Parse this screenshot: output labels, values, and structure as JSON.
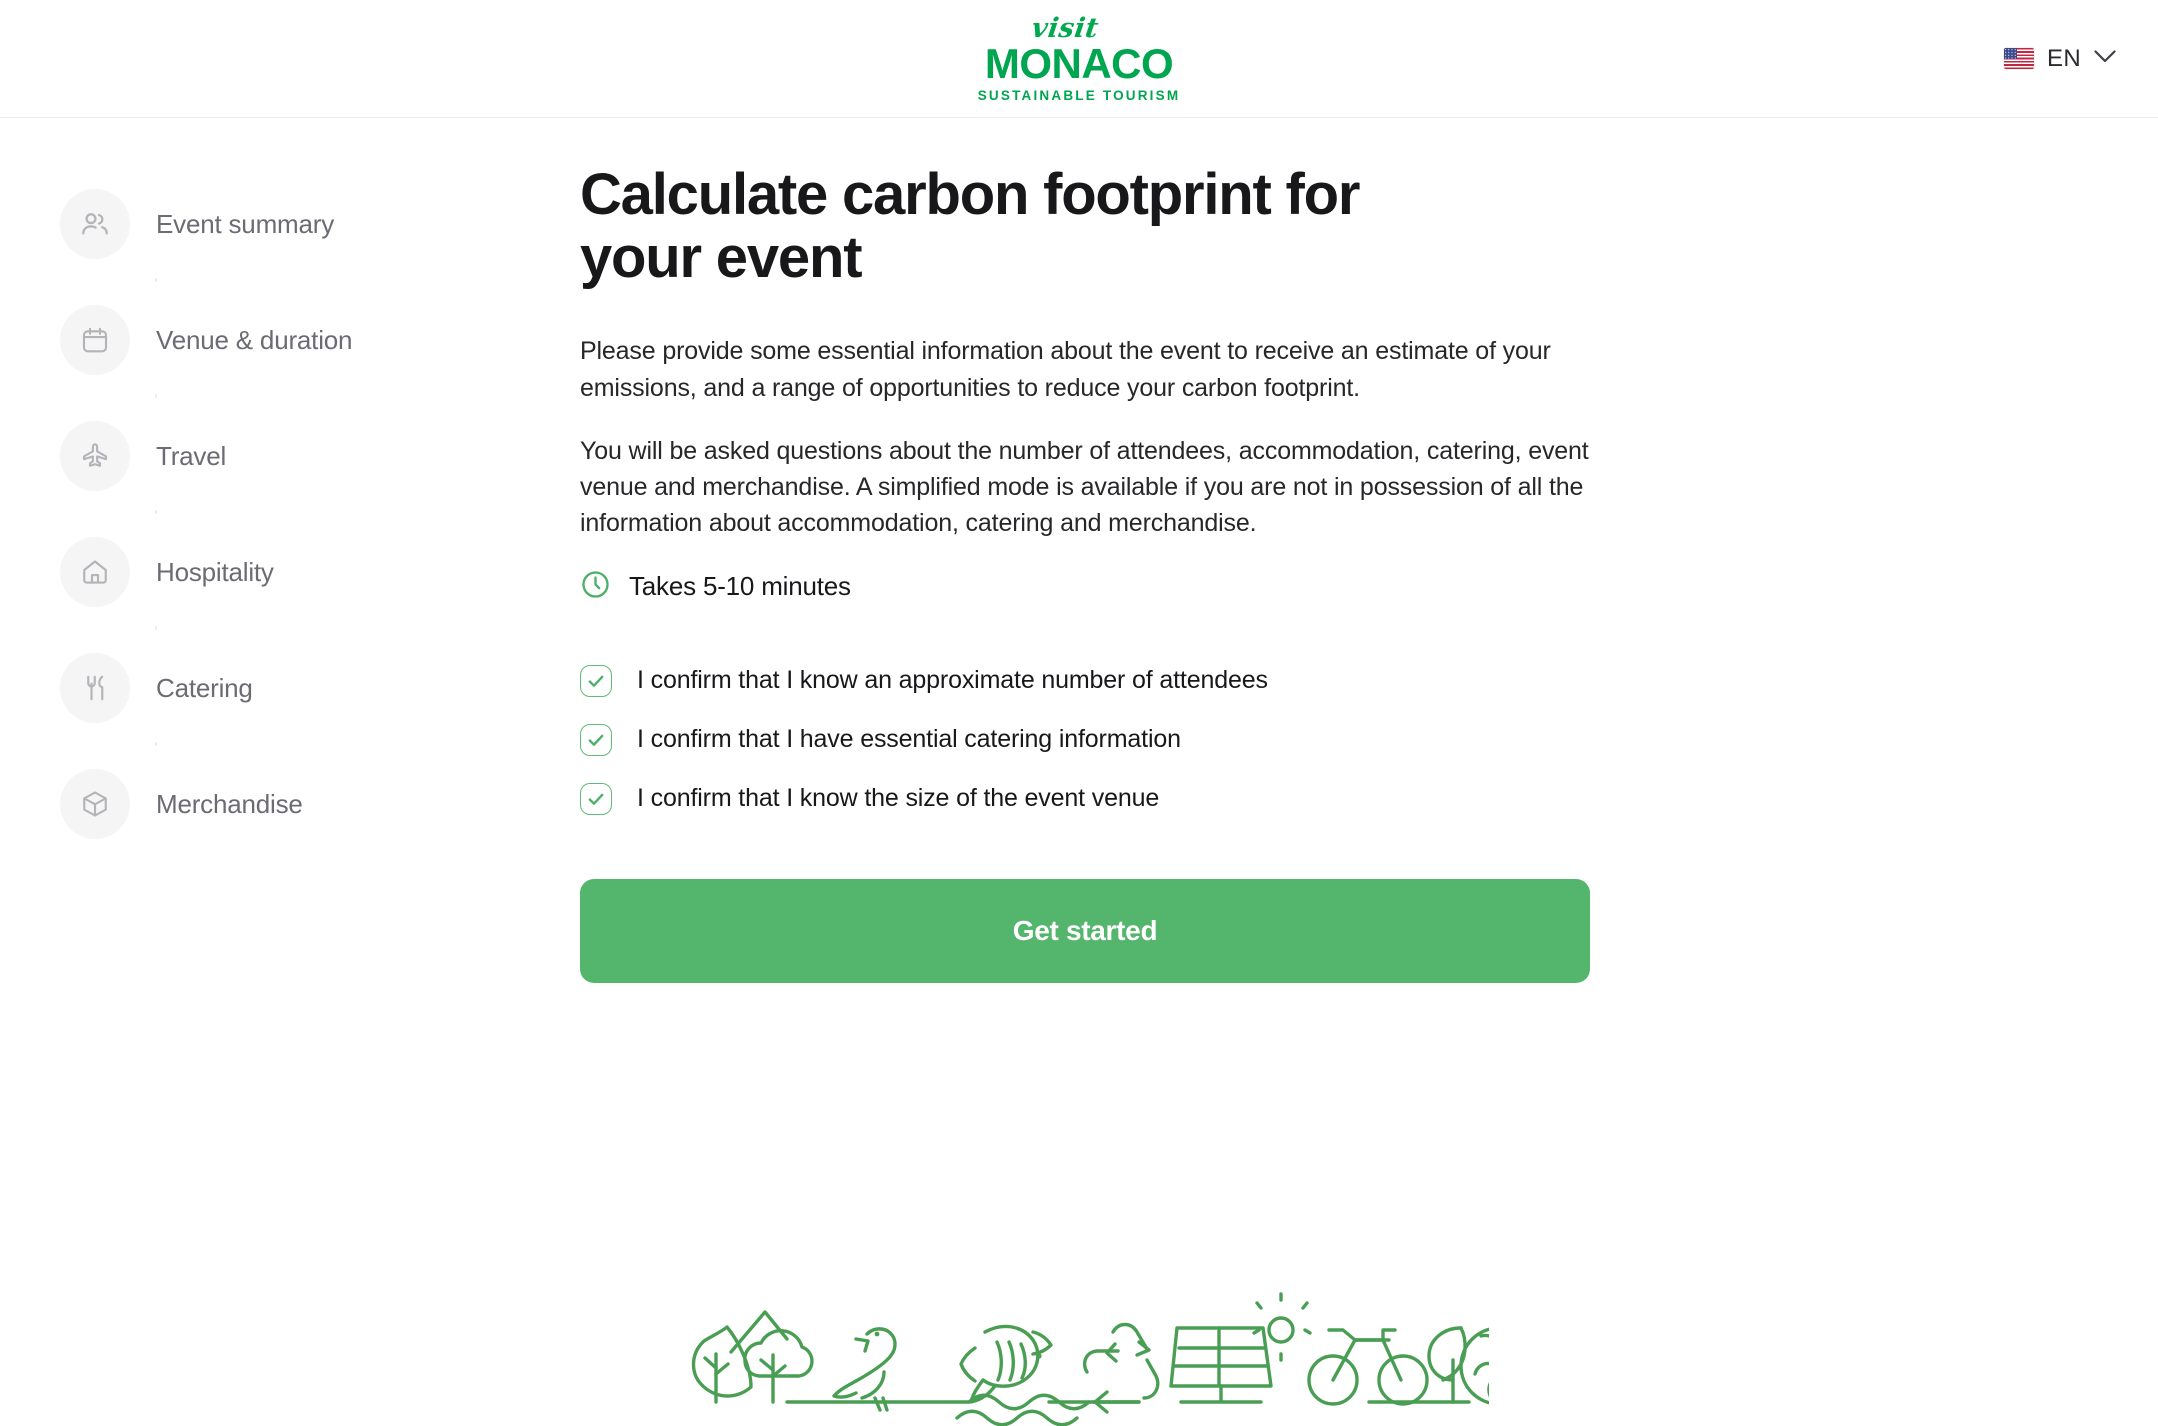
{
  "header": {
    "logo": {
      "script_word": "visit",
      "brand": "MONACO",
      "tagline": "SUSTAINABLE TOURISM"
    },
    "language": {
      "flag_icon": "us-flag-icon",
      "code": "EN",
      "chevron_icon": "chevron-down-icon"
    }
  },
  "sidebar": {
    "items": [
      {
        "label": "Event summary",
        "icon": "users-icon"
      },
      {
        "label": "Venue & duration",
        "icon": "calendar-icon"
      },
      {
        "label": "Travel",
        "icon": "airplane-icon"
      },
      {
        "label": "Hospitality",
        "icon": "house-icon"
      },
      {
        "label": "Catering",
        "icon": "fork-knife-icon"
      },
      {
        "label": "Merchandise",
        "icon": "box-icon"
      }
    ]
  },
  "main": {
    "title": "Calculate carbon footprint for your event",
    "paragraph_1": "Please provide some essential information about the event to receive an estimate of your emissions, and a range of opportunities to reduce your carbon footprint.",
    "paragraph_2": "You will be asked questions about the number of attendees, accommodation, catering, event venue and merchandise. A simplified mode is available if you are not in possession of all the information about accommodation, catering and merchandise.",
    "duration": {
      "icon": "clock-icon",
      "text": "Takes 5-10 minutes"
    },
    "checklist": [
      {
        "label": "I confirm that I know an approximate number of attendees",
        "checked": true
      },
      {
        "label": "I confirm that I have essential catering information",
        "checked": true
      },
      {
        "label": "I confirm that I know the size of the event venue",
        "checked": true
      }
    ],
    "cta_label": "Get started"
  },
  "footer": {
    "illustration_icons": [
      "leaf-icon",
      "tree-icon",
      "bird-icon",
      "fish-icon",
      "waves-icon",
      "recycle-icon",
      "solar-panel-icon",
      "sun-icon",
      "bicycle-icon",
      "leaf-globe-icon"
    ]
  },
  "colors": {
    "brand_green": "#00a550",
    "accent_green": "#54b56c",
    "check_green": "#61bb78",
    "text_dark": "#18181b",
    "text_muted": "#6b6b73",
    "bullet_bg": "#f5f5f6"
  }
}
